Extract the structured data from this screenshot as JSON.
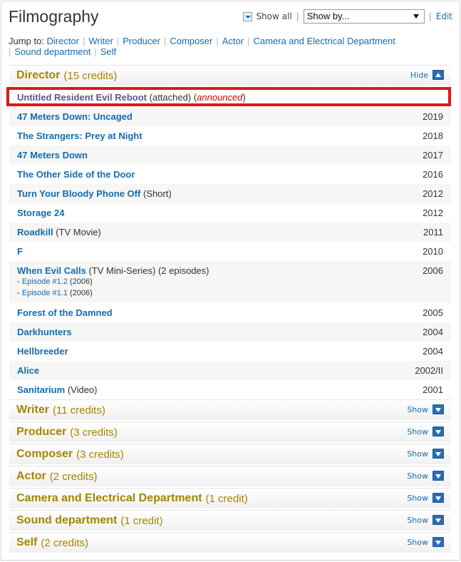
{
  "title": "Filmography",
  "toolbar": {
    "show_all": "Show all",
    "show_by": "Show by...",
    "edit": "Edit"
  },
  "jump": {
    "label": "Jump to:",
    "links": [
      "Director",
      "Writer",
      "Producer",
      "Composer",
      "Actor",
      "Camera and Electrical Department",
      "Sound department",
      "Self"
    ]
  },
  "director": {
    "name": "Director",
    "count": "(15 credits)",
    "toggle": "Hide",
    "credits": [
      {
        "title": "Untitled Resident Evil Reboot",
        "extra": "(attached)",
        "status": "announced",
        "year": ""
      },
      {
        "title": "47 Meters Down: Uncaged",
        "extra": "",
        "year": "2019"
      },
      {
        "title": "The Strangers: Prey at Night",
        "extra": "",
        "year": "2018"
      },
      {
        "title": "47 Meters Down",
        "extra": "",
        "year": "2017"
      },
      {
        "title": "The Other Side of the Door",
        "extra": "",
        "year": "2016"
      },
      {
        "title": "Turn Your Bloody Phone Off",
        "extra": "(Short)",
        "year": "2012"
      },
      {
        "title": "Storage 24",
        "extra": "",
        "year": "2012"
      },
      {
        "title": "Roadkill",
        "extra": "(TV Movie)",
        "year": "2011"
      },
      {
        "title": "F",
        "extra": "",
        "year": "2010"
      },
      {
        "title": "When Evil Calls",
        "extra": "(TV Mini-Series) (2 episodes)",
        "year": "2006",
        "episodes": [
          {
            "name": "Episode #1.2",
            "year": "(2006)"
          },
          {
            "name": "Episode #1.1",
            "year": "(2006)"
          }
        ]
      },
      {
        "title": "Forest of the Damned",
        "extra": "",
        "year": "2005"
      },
      {
        "title": "Darkhunters",
        "extra": "",
        "year": "2004"
      },
      {
        "title": "Hellbreeder",
        "extra": "",
        "year": "2004"
      },
      {
        "title": "Alice",
        "extra": "",
        "year": "2002/II"
      },
      {
        "title": "Sanitarium",
        "extra": "(Video)",
        "year": "2001"
      }
    ]
  },
  "collapsed": [
    {
      "name": "Writer",
      "count": "(11 credits)",
      "toggle": "Show"
    },
    {
      "name": "Producer",
      "count": "(3 credits)",
      "toggle": "Show"
    },
    {
      "name": "Composer",
      "count": "(3 credits)",
      "toggle": "Show"
    },
    {
      "name": "Actor",
      "count": "(2 credits)",
      "toggle": "Show"
    },
    {
      "name": "Camera and Electrical Department",
      "count": "(1 credit)",
      "toggle": "Show"
    },
    {
      "name": "Sound department",
      "count": "(1 credit)",
      "toggle": "Show"
    },
    {
      "name": "Self",
      "count": "(2 credits)",
      "toggle": "Show"
    }
  ],
  "icons": {
    "show_all": "expand-all-icon",
    "hide": "collapse-icon",
    "show": "expand-icon"
  },
  "colors": {
    "link": "#136cb2",
    "category": "#a58500",
    "highlight_border": "#e0141c",
    "announced": "#dd0000"
  }
}
